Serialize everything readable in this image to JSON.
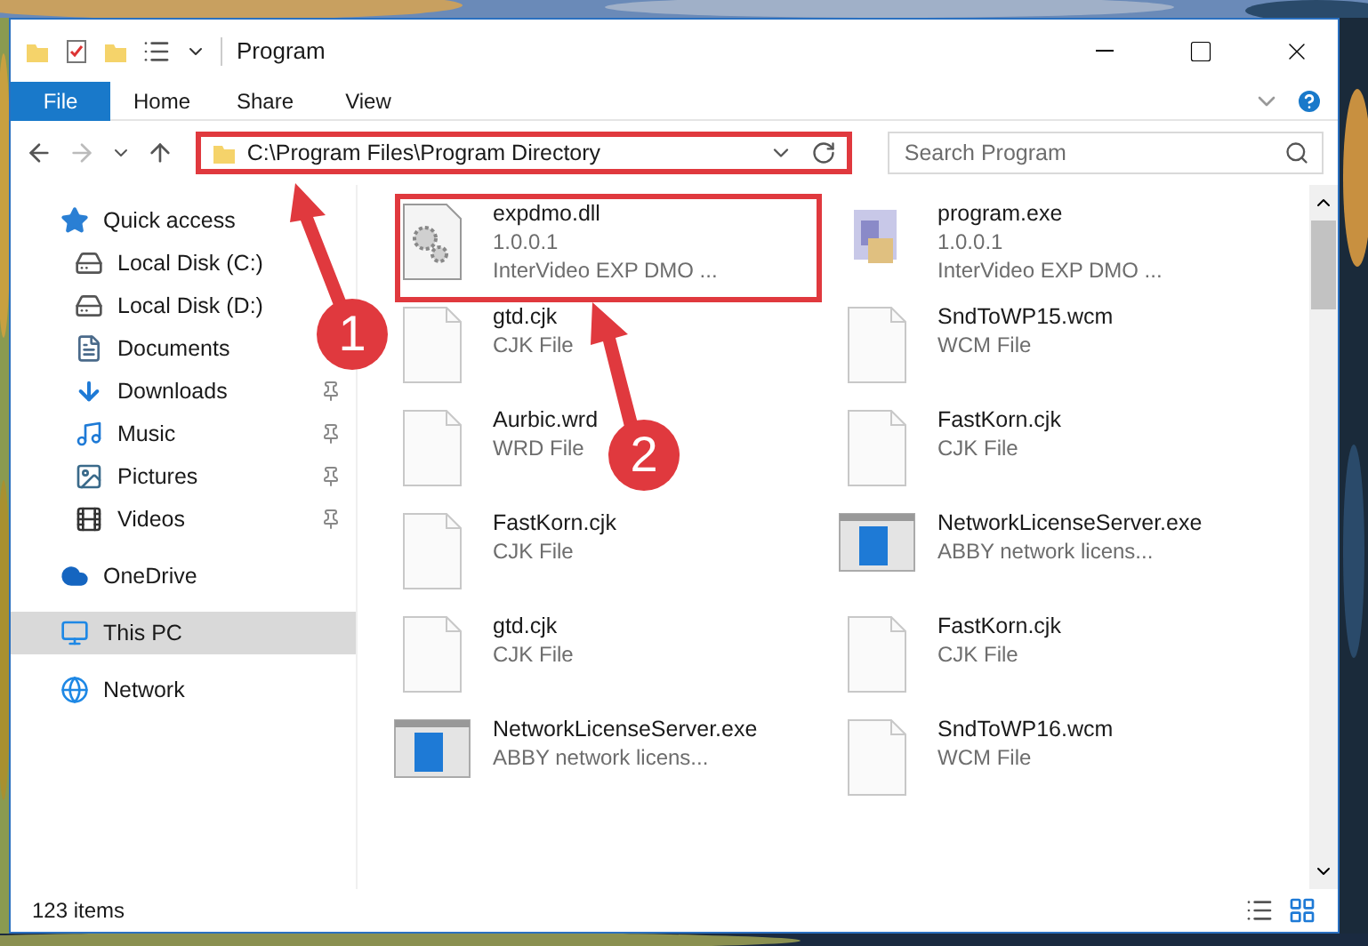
{
  "window": {
    "title": "Program"
  },
  "ribbon_tabs": [
    {
      "label": "File",
      "selected": true
    },
    {
      "label": "Home",
      "selected": false
    },
    {
      "label": "Share",
      "selected": false
    },
    {
      "label": "View",
      "selected": false
    }
  ],
  "address_bar": {
    "value": "C:\\Program Files\\Program Directory"
  },
  "search": {
    "placeholder": "Search Program"
  },
  "sidebar": {
    "items": [
      {
        "label": "Quick access",
        "kind": "star",
        "selected": false,
        "children": [
          {
            "label": "Local Disk (C:)",
            "kind": "disk",
            "pinned": false,
            "selected": false
          },
          {
            "label": "Local Disk (D:)",
            "kind": "disk",
            "pinned": false,
            "selected": false
          },
          {
            "label": "Documents",
            "kind": "doc",
            "pinned": false,
            "selected": false
          },
          {
            "label": "Downloads",
            "kind": "download",
            "pinned": true,
            "selected": false
          },
          {
            "label": "Music",
            "kind": "music",
            "pinned": true,
            "selected": false
          },
          {
            "label": "Pictures",
            "kind": "pictures",
            "pinned": true,
            "selected": false
          },
          {
            "label": "Videos",
            "kind": "videos",
            "pinned": true,
            "selected": false
          }
        ]
      },
      {
        "label": "OneDrive",
        "kind": "cloud",
        "selected": false
      },
      {
        "label": "This PC",
        "kind": "pc",
        "selected": true
      },
      {
        "label": "Network",
        "kind": "network",
        "selected": false
      }
    ]
  },
  "files": [
    {
      "name": "expdmo.dll",
      "lines": [
        "1.0.0.1",
        "InterVideo EXP DMO ..."
      ],
      "kind": "gear"
    },
    {
      "name": "program.exe",
      "lines": [
        "1.0.0.1",
        "InterVideo EXP DMO ..."
      ],
      "kind": "setup"
    },
    {
      "name": "gtd.cjk",
      "lines": [
        "CJK File"
      ],
      "kind": "doc"
    },
    {
      "name": "SndToWP15.wcm",
      "lines": [
        "WCM File"
      ],
      "kind": "doc"
    },
    {
      "name": "Aurbic.wrd",
      "lines": [
        "WRD File"
      ],
      "kind": "doc"
    },
    {
      "name": "FastKorn.cjk",
      "lines": [
        "CJK File"
      ],
      "kind": "doc"
    },
    {
      "name": "FastKorn.cjk",
      "lines": [
        "CJK File"
      ],
      "kind": "doc"
    },
    {
      "name": "NetworkLicenseServer.exe",
      "lines": [
        "ABBY network licens..."
      ],
      "kind": "app"
    },
    {
      "name": "gtd.cjk",
      "lines": [
        "CJK File"
      ],
      "kind": "doc"
    },
    {
      "name": "FastKorn.cjk",
      "lines": [
        "CJK File"
      ],
      "kind": "doc"
    },
    {
      "name": "NetworkLicenseServer.exe",
      "lines": [
        "ABBY network licens..."
      ],
      "kind": "app"
    },
    {
      "name": "SndToWP16.wcm",
      "lines": [
        "WCM File"
      ],
      "kind": "doc"
    }
  ],
  "status_bar": {
    "count": "123 items"
  },
  "annotations": [
    {
      "number": "1"
    },
    {
      "number": "2"
    }
  ]
}
